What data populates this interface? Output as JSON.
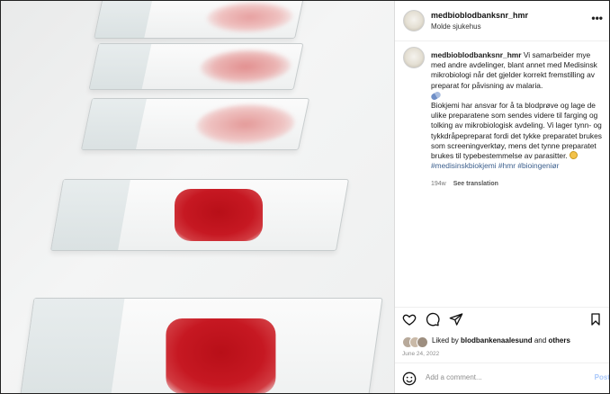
{
  "post": {
    "username": "medbioblodbanksnr_hmr",
    "location": "Molde sjukehus",
    "more_label": "•••",
    "caption_username": "medbioblodbanksnr_hmr",
    "caption_p1": "Vi samarbeider mye med andre avdelinger, blant annet med Medisinsk mikrobiologi når det gjelder korrekt fremstilling av preparat for påvisning av malaria.",
    "caption_p2": "Biokjemi har ansvar for å ta blodprøve og lage de ulike preparatene som sendes videre til farging og tolking av mikrobiologisk avdeling. Vi lager tynn- og tykkdråpepreparat fordi det tykke preparatet brukes som screeningverktøy, mens det tynne preparatet brukes til typebestemmelse av parasitter.",
    "hashtags": "#medisinskbiokjemi #hmr #bioingeniør",
    "age": "194w",
    "see_translation": "See translation",
    "liked_by_prefix": "Liked by",
    "liked_by_user": "blodbankenaalesund",
    "liked_by_and": "and",
    "liked_by_others": "others",
    "date": "June 24, 2022",
    "comment_placeholder": "Add a comment...",
    "post_label": "Post"
  },
  "icons": [
    "heart-icon",
    "comment-icon",
    "share-icon",
    "bookmark-icon",
    "smile-icon",
    "more-icon"
  ],
  "colors": {
    "link": "#3b5e8c",
    "blood": "#c61822",
    "post": "#a8c7fa"
  }
}
